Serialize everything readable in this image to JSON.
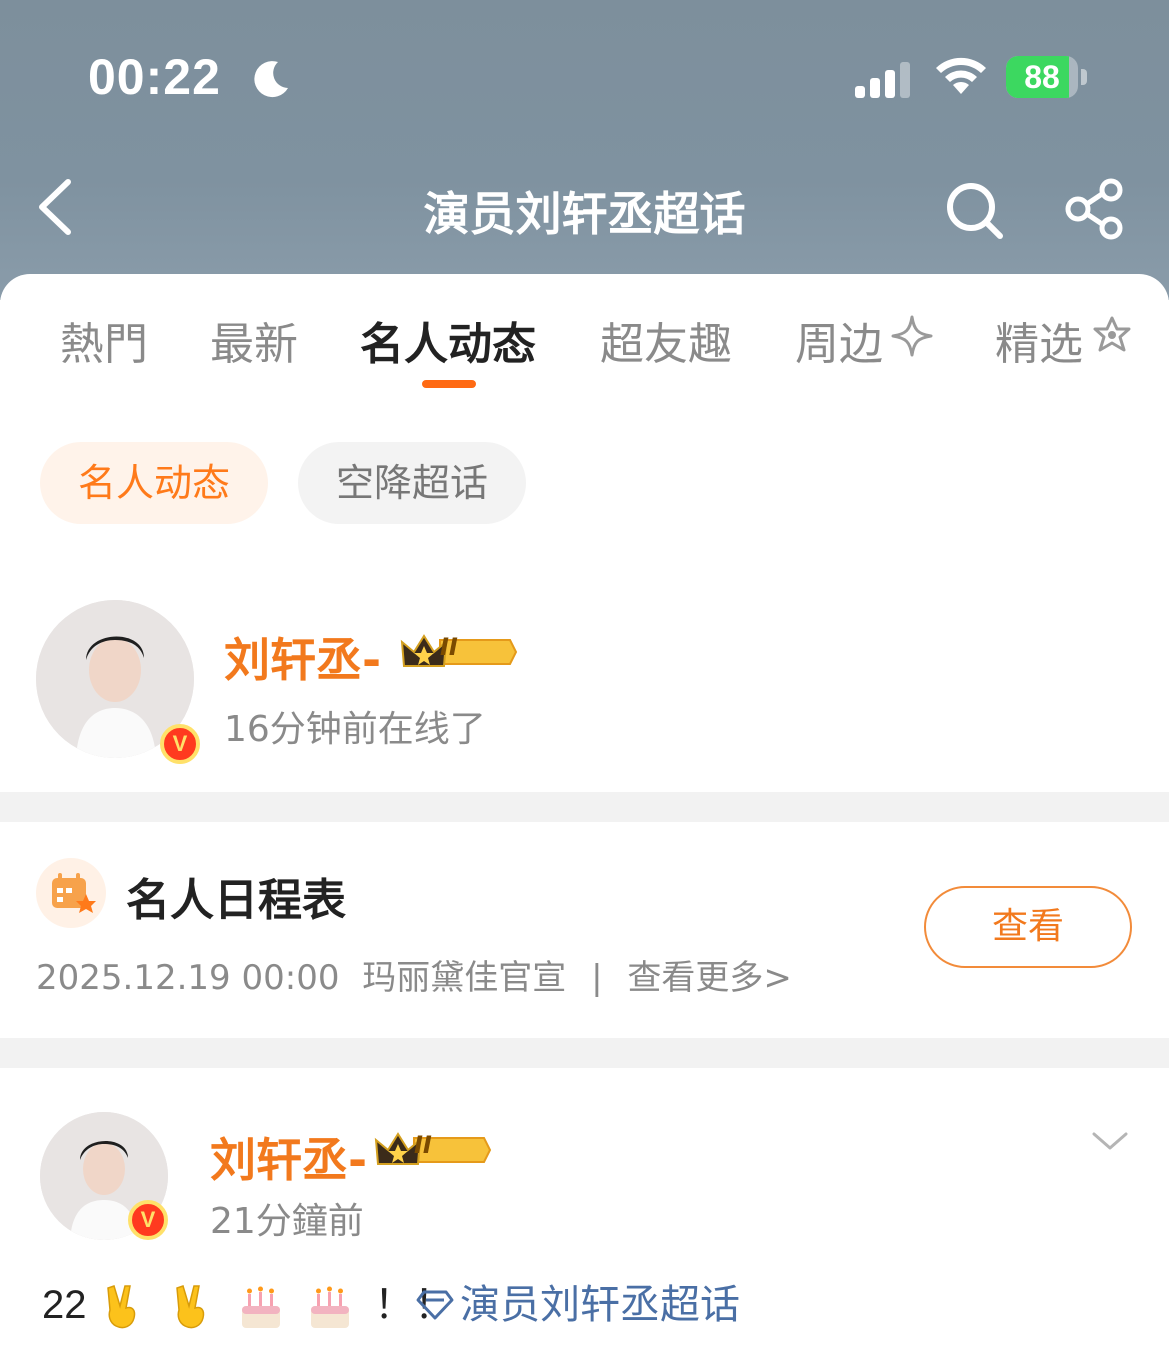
{
  "status_bar": {
    "time": "00:22",
    "battery_level": "88",
    "battery_fraction": 0.88
  },
  "nav": {
    "title": "演员刘轩丞超话"
  },
  "tabs": [
    {
      "label": "熱門",
      "active": false
    },
    {
      "label": "最新",
      "active": false
    },
    {
      "label": "名人动态",
      "active": true
    },
    {
      "label": "超友趣",
      "active": false
    },
    {
      "label": "周边",
      "active": false
    },
    {
      "label": "精选",
      "active": false
    }
  ],
  "chips": [
    {
      "label": "名人动态",
      "active": true
    },
    {
      "label": "空降超话",
      "active": false
    }
  ],
  "celebrity": {
    "name": "刘轩丞-",
    "level": "II",
    "online_status": "16分钟前在线了",
    "verified_mark": "V"
  },
  "schedule": {
    "title": "名人日程表",
    "datetime": "2025.12.19 00:00",
    "event": "玛丽黛佳官宣",
    "separator": "|",
    "more": "查看更多>",
    "button_label": "查看"
  },
  "post": {
    "author": "刘轩丞-",
    "level": "II",
    "time": "21分鐘前",
    "verified_mark": "V",
    "text_prefix": "22",
    "text_suffix": "！！",
    "emojis": [
      "victory-hand",
      "victory-hand",
      "birthday-cake",
      "birthday-cake"
    ],
    "topic": "演员刘轩丞超话"
  },
  "colors": {
    "accent": "#ff6a13",
    "name_orange": "#f2791d",
    "link_blue": "#4a6fa5",
    "header_bg": "#7f92a0"
  }
}
